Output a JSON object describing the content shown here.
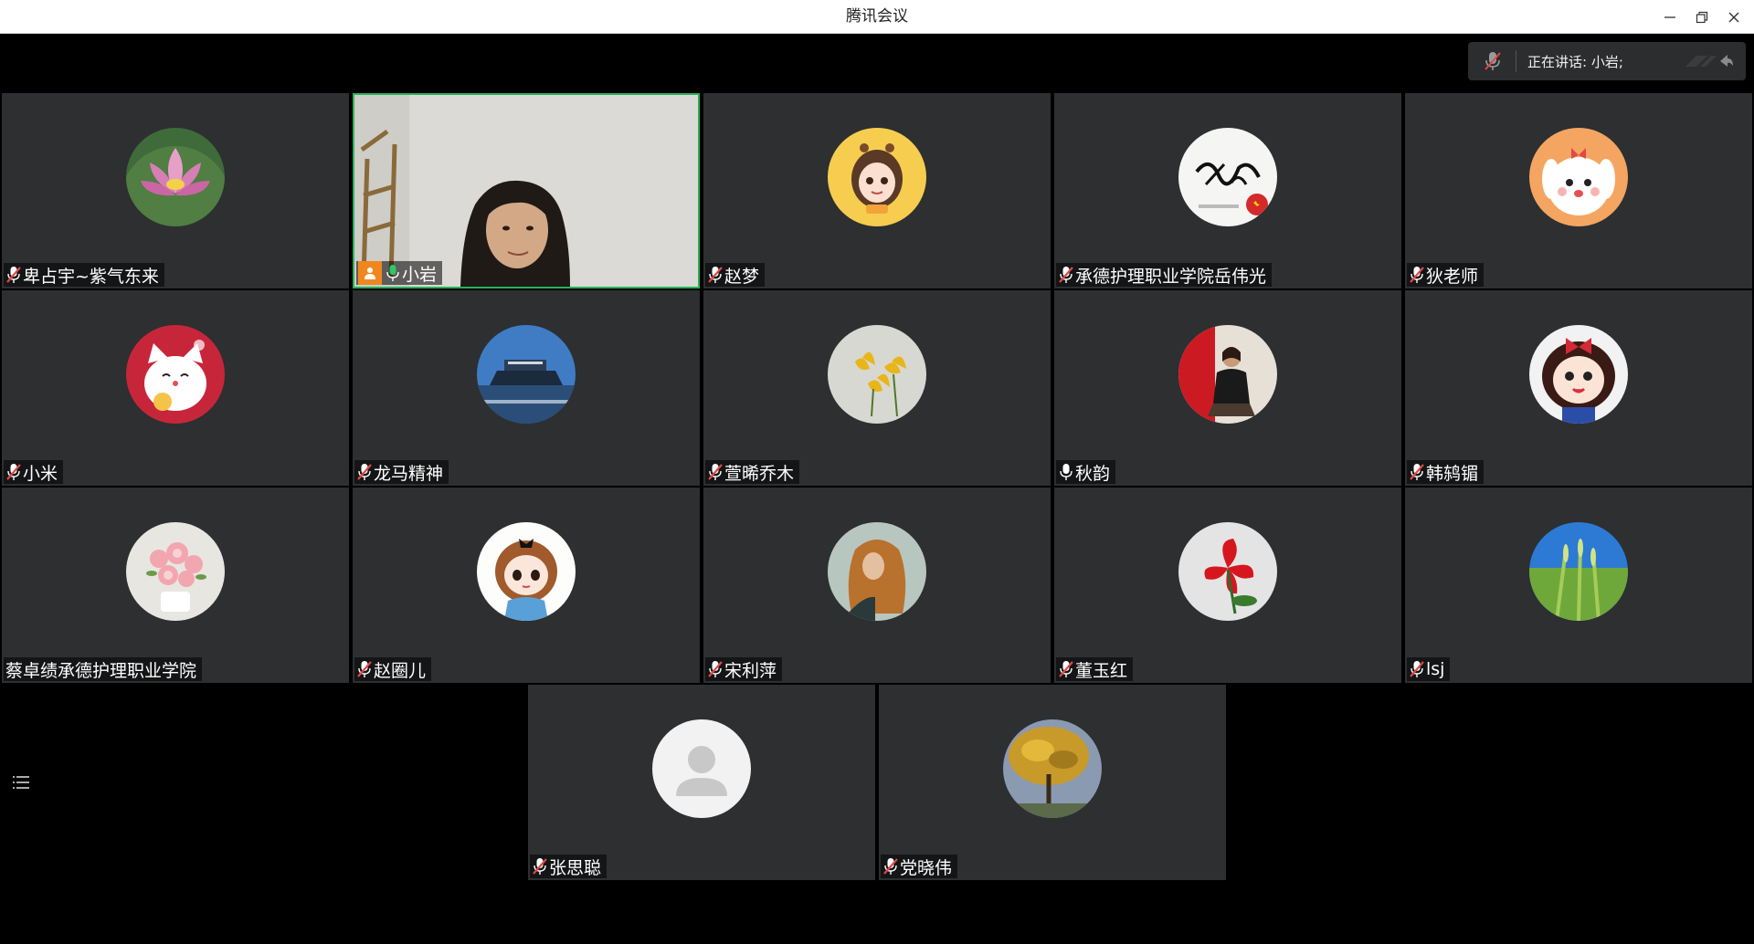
{
  "window": {
    "title": "腾讯会议"
  },
  "speaking": {
    "text": "正在讲话: 小岩;"
  },
  "participants": [
    {
      "name": "卑占宇~紫气东来",
      "mic": "muted",
      "avatar": "lotus"
    },
    {
      "name": "小岩",
      "mic": "active",
      "avatar": "video",
      "host": true
    },
    {
      "name": "赵梦",
      "mic": "muted",
      "avatar": "cartoon-girl"
    },
    {
      "name": "承德护理职业学院岳伟光",
      "mic": "muted",
      "avatar": "calligraphy"
    },
    {
      "name": "狄老师",
      "mic": "muted",
      "avatar": "cartoon-bunny"
    },
    {
      "name": "小米",
      "mic": "muted",
      "avatar": "lucky-cat"
    },
    {
      "name": "龙马精神",
      "mic": "muted",
      "avatar": "ship"
    },
    {
      "name": "萱晞乔木",
      "mic": "muted",
      "avatar": "yellow-lily"
    },
    {
      "name": "秋韵",
      "mic": "unmuted",
      "avatar": "woman-red"
    },
    {
      "name": "韩鸫镅",
      "mic": "muted",
      "avatar": "cartoon-red-girl"
    },
    {
      "name": "蔡卓绩承德护理职业学院",
      "mic": "none",
      "avatar": "pink-flowers"
    },
    {
      "name": "赵圈儿",
      "mic": "muted",
      "avatar": "chibi-girl"
    },
    {
      "name": "宋利萍",
      "mic": "muted",
      "avatar": "curly-hair-woman"
    },
    {
      "name": "董玉红",
      "mic": "muted",
      "avatar": "red-flower"
    },
    {
      "name": "lsj",
      "mic": "muted",
      "avatar": "wheat"
    },
    {
      "name": "张思聪",
      "mic": "muted",
      "avatar": "default-user"
    },
    {
      "name": "党晓伟",
      "mic": "muted",
      "avatar": "ginkgo-tree"
    }
  ],
  "colors": {
    "tile_bg": "#2d2f31",
    "active_border": "#25b35a",
    "host_badge": "#f0871e",
    "muted_mic": "#e14848"
  }
}
